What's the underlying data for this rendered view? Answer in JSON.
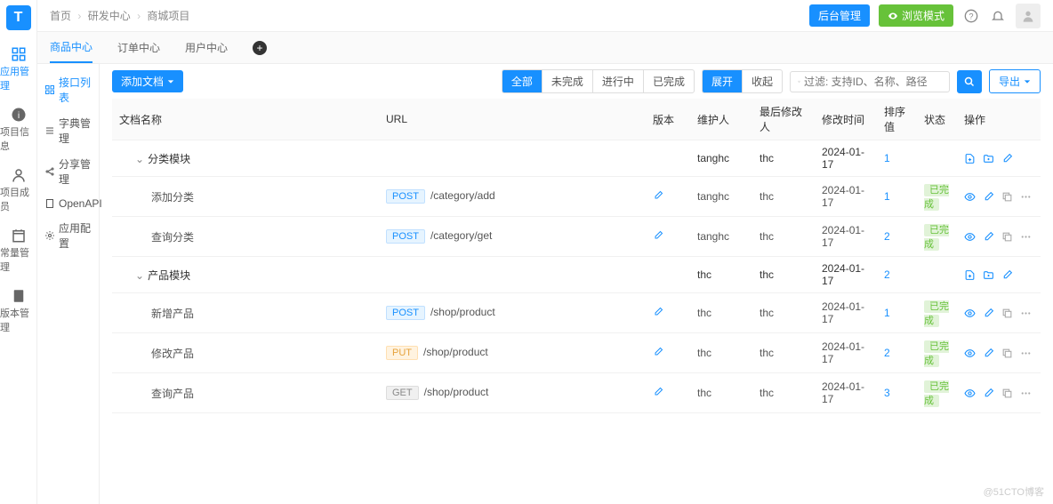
{
  "logo": "T",
  "rail": [
    {
      "label": "应用管理",
      "active": true
    },
    {
      "label": "项目信息"
    },
    {
      "label": "项目成员"
    },
    {
      "label": "常量管理"
    },
    {
      "label": "版本管理"
    }
  ],
  "breadcrumb": [
    "首页",
    "研发中心",
    "商城项目"
  ],
  "top": {
    "backstage": "后台管理",
    "preview": "浏览模式"
  },
  "tabs": [
    "商品中心",
    "订单中心",
    "用户中心"
  ],
  "side_menu": [
    {
      "label": "接口列表",
      "active": true
    },
    {
      "label": "字典管理"
    },
    {
      "label": "分享管理"
    },
    {
      "label": "OpenAPI"
    },
    {
      "label": "应用配置"
    }
  ],
  "toolbar": {
    "add_doc": "添加文档",
    "filters": [
      "全部",
      "未完成",
      "进行中",
      "已完成"
    ],
    "expand": "展开",
    "collapse": "收起",
    "search_placeholder": "过滤: 支持ID、名称、路径",
    "export": "导出"
  },
  "columns": {
    "name": "文档名称",
    "url": "URL",
    "version": "版本",
    "maintainer": "维护人",
    "modifier": "最后修改人",
    "mtime": "修改时间",
    "sort": "排序值",
    "status": "状态",
    "ops": "操作"
  },
  "groups": [
    {
      "name": "分类模块",
      "maintainer": "tanghc",
      "modifier": "thc",
      "mtime": "2024-01-17",
      "sort": "1",
      "rows": [
        {
          "name": "添加分类",
          "method": "POST",
          "url": "/category/add",
          "maintainer": "tanghc",
          "modifier": "thc",
          "mtime": "2024-01-17",
          "sort": "1",
          "status": "已完成"
        },
        {
          "name": "查询分类",
          "method": "POST",
          "url": "/category/get",
          "maintainer": "tanghc",
          "modifier": "thc",
          "mtime": "2024-01-17",
          "sort": "2",
          "status": "已完成"
        }
      ]
    },
    {
      "name": "产品模块",
      "maintainer": "thc",
      "modifier": "thc",
      "mtime": "2024-01-17",
      "sort": "2",
      "rows": [
        {
          "name": "新增产品",
          "method": "POST",
          "url": "/shop/product",
          "maintainer": "thc",
          "modifier": "thc",
          "mtime": "2024-01-17",
          "sort": "1",
          "status": "已完成"
        },
        {
          "name": "修改产品",
          "method": "PUT",
          "url": "/shop/product",
          "maintainer": "thc",
          "modifier": "thc",
          "mtime": "2024-01-17",
          "sort": "2",
          "status": "已完成"
        },
        {
          "name": "查询产品",
          "method": "GET",
          "url": "/shop/product",
          "maintainer": "thc",
          "modifier": "thc",
          "mtime": "2024-01-17",
          "sort": "3",
          "status": "已完成"
        }
      ]
    }
  ],
  "watermark": "@51CTO博客"
}
